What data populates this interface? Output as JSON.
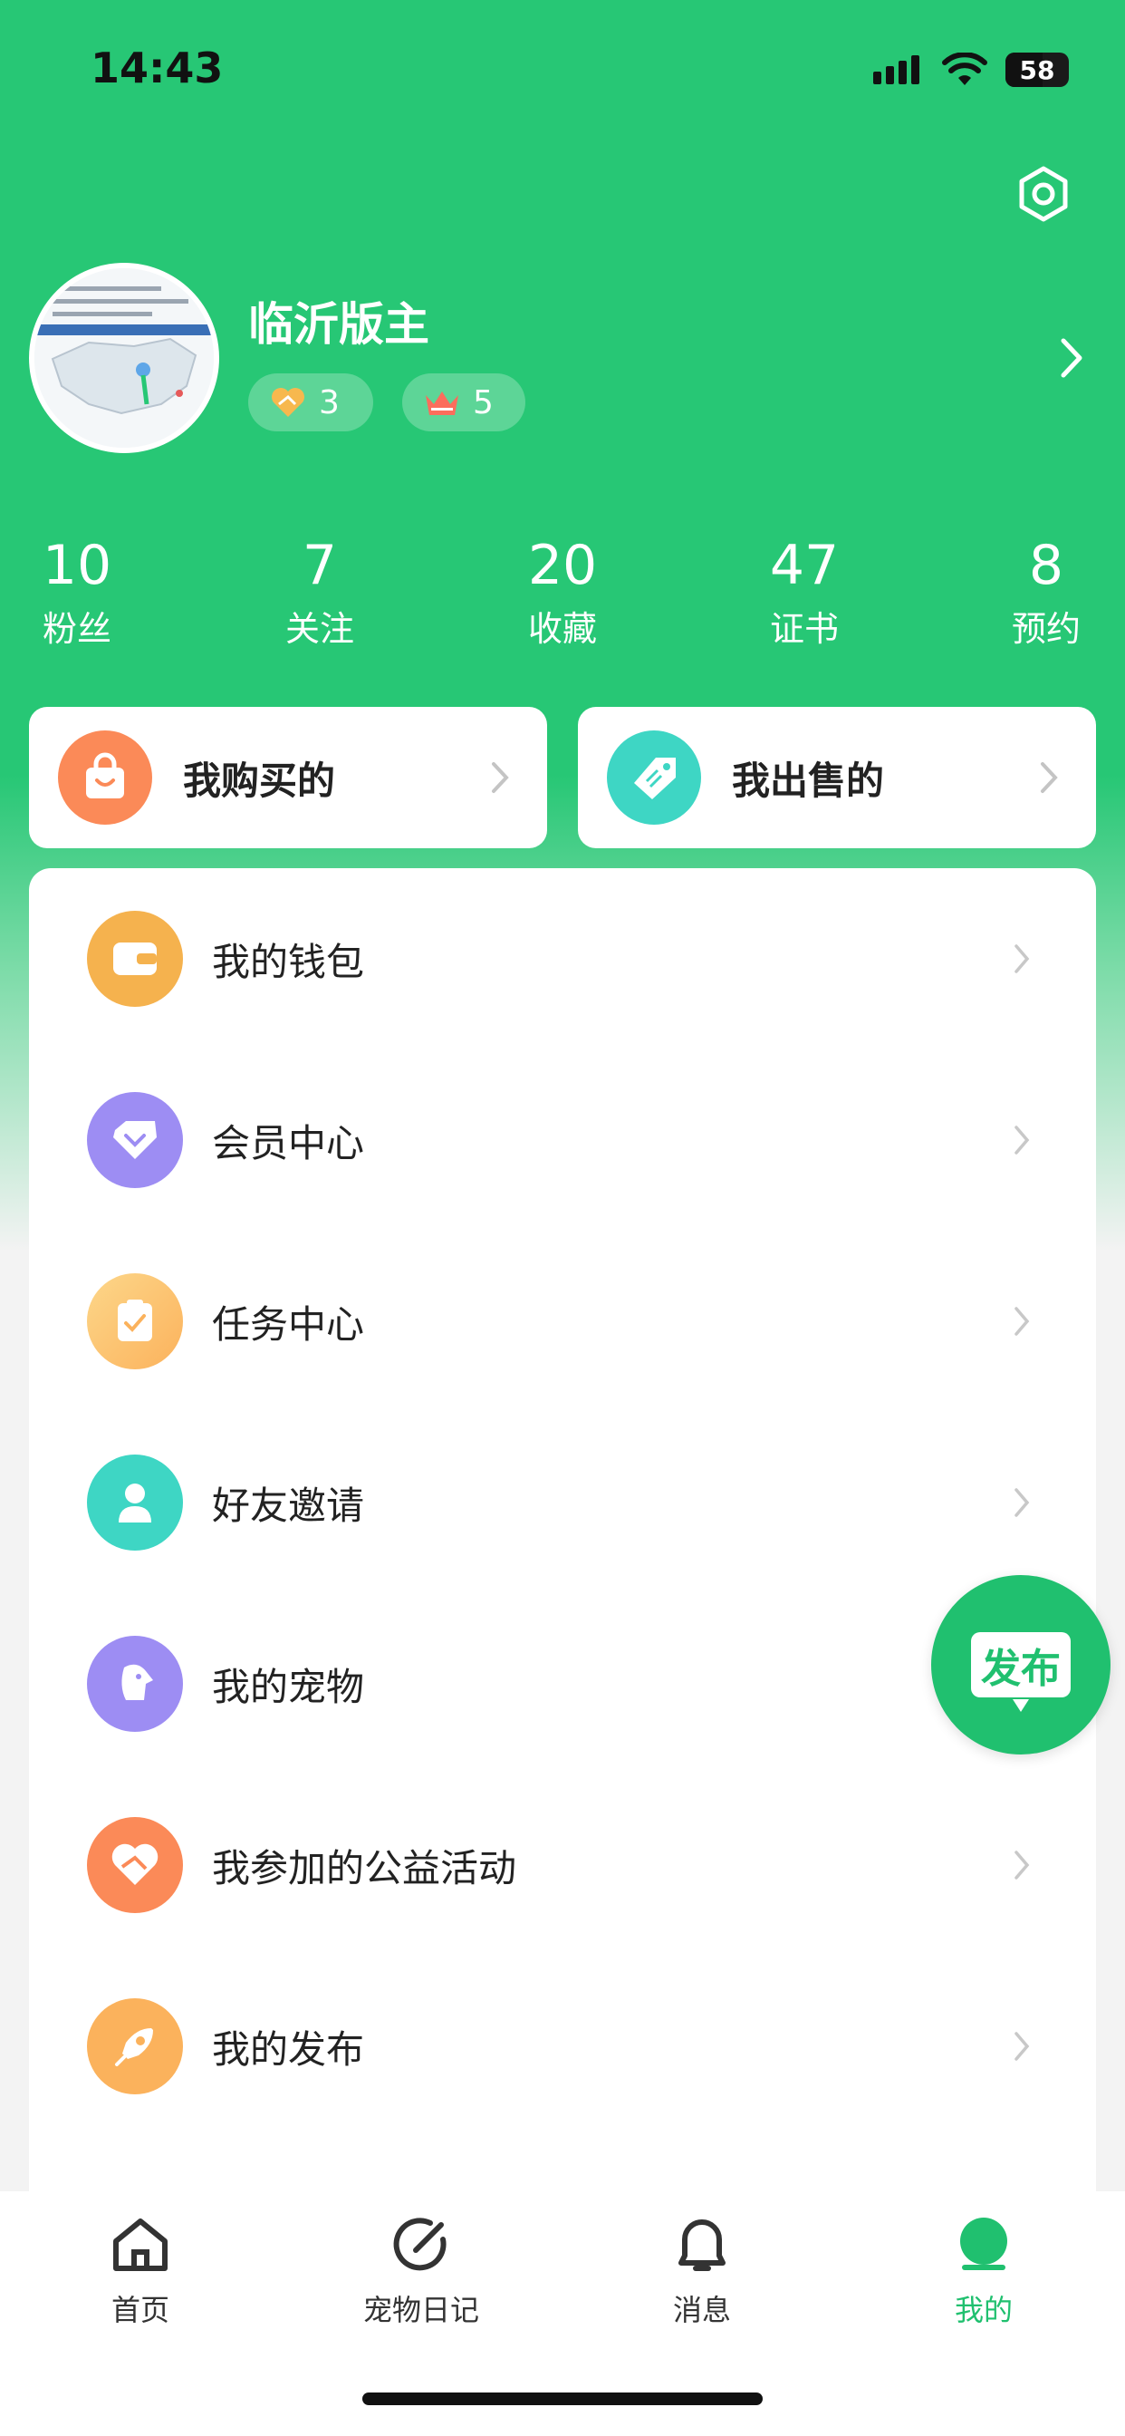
{
  "status_bar": {
    "time": "14:43",
    "battery": "58"
  },
  "profile": {
    "username": "临沂版主",
    "love_count": "3",
    "crown_count": "5"
  },
  "stats": [
    {
      "value": "10",
      "label": "粉丝"
    },
    {
      "value": "7",
      "label": "关注"
    },
    {
      "value": "20",
      "label": "收藏"
    },
    {
      "value": "47",
      "label": "证书"
    },
    {
      "value": "8",
      "label": "预约"
    }
  ],
  "quick": {
    "bought": "我购买的",
    "sold": "我出售的"
  },
  "menu": [
    {
      "label": "我的钱包",
      "icon": "wallet-icon",
      "color": "#f5b24e"
    },
    {
      "label": "会员中心",
      "icon": "diamond-icon",
      "color": "#9d8df3"
    },
    {
      "label": "任务中心",
      "icon": "clipboard-check-icon",
      "color": "#fbc26a"
    },
    {
      "label": "好友邀请",
      "icon": "friend-icon",
      "color": "#3ed6c4"
    },
    {
      "label": "我的宠物",
      "icon": "dog-icon",
      "color": "#9d8df3"
    },
    {
      "label": "我参加的公益活动",
      "icon": "heart-hands-icon",
      "color": "#fb8a58"
    },
    {
      "label": "我的发布",
      "icon": "rocket-icon",
      "color": "#fbb25c"
    }
  ],
  "fab": {
    "label": "发布"
  },
  "tabs": [
    {
      "label": "首页"
    },
    {
      "label": "宠物日记"
    },
    {
      "label": "消息"
    },
    {
      "label": "我的"
    }
  ],
  "colors": {
    "brand": "#27c775",
    "active_tab": "#20c06f"
  }
}
